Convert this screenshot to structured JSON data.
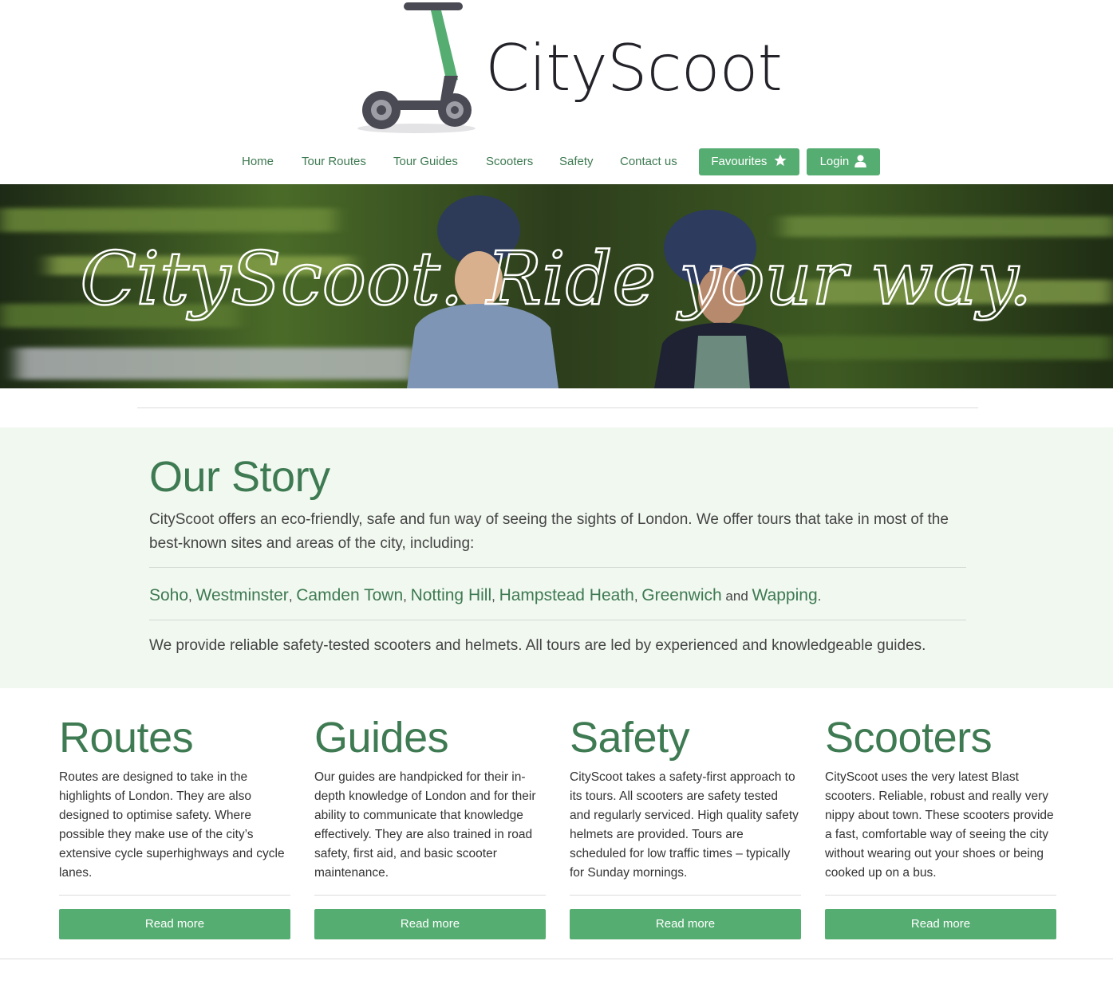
{
  "brand": {
    "name": "CityScoot"
  },
  "nav": {
    "items": [
      "Home",
      "Tour Routes",
      "Tour Guides",
      "Scooters",
      "Safety",
      "Contact us"
    ],
    "favourites_label": "Favourites",
    "login_label": "Login"
  },
  "hero": {
    "tagline": "CityScoot. Ride your way."
  },
  "story": {
    "title": "Our Story",
    "intro": "CityScoot offers an eco-friendly, safe and fun way of seeing the sights of London. We offer tours that take in most of the best-known sites and areas of the city, including:",
    "places": [
      "Soho",
      "Westminster",
      "Camden Town",
      "Notting Hill",
      "Hampstead Heath",
      "Greenwich",
      "Wapping"
    ],
    "and_word": "and",
    "closing": "We provide reliable safety-tested scooters and helmets. All tours are led by experienced and knowledgeable guides."
  },
  "features": [
    {
      "title": "Routes",
      "text": "Routes are designed to take in the highlights of London. They are also designed to optimise safety. Where possible they make use of the city’s extensive cycle superhighways and cycle lanes.",
      "button": "Read more"
    },
    {
      "title": "Guides",
      "text": "Our guides are handpicked for their in-depth knowledge of London and for their ability to communicate that knowledge effectively. They are also trained in road safety, first aid, and basic scooter maintenance.",
      "button": "Read more"
    },
    {
      "title": "Safety",
      "text": "CityScoot takes a safety-first approach to its tours. All scooters are safety tested and regularly serviced. High quality safety helmets are provided. Tours are scheduled for low traffic times – typically for Sunday mornings.",
      "button": "Read more"
    },
    {
      "title": "Scooters",
      "text": "CityScoot uses the very latest Blast scooters. Reliable, robust and really very nippy about town. These scooters provide a fast, comfortable way of seeing the city without wearing out your shoes or being cooked up on a bus.",
      "button": "Read more"
    }
  ],
  "colors": {
    "accent": "#56ad72",
    "accent_text": "#3e7a52",
    "story_bg": "#f1f8f0",
    "logo_text": "#23232a"
  },
  "icons": {
    "favourites": "star-icon",
    "login": "user-icon",
    "logo": "scooter-icon"
  }
}
